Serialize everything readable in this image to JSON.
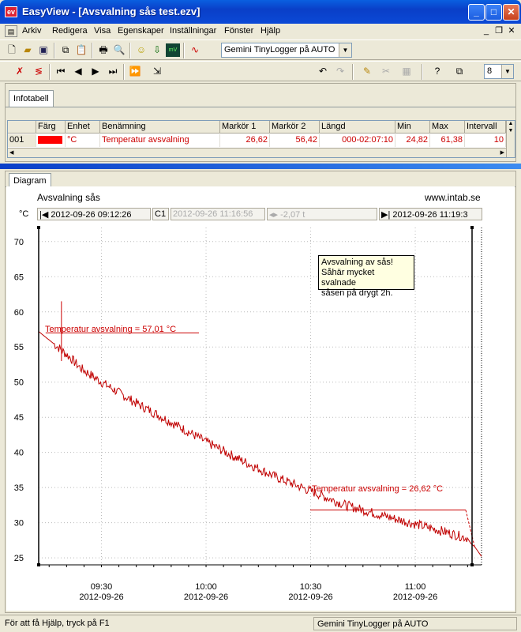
{
  "window": {
    "title": "EasyView - [Avsvalning sås test.ezv]",
    "icon": "ev"
  },
  "menu": [
    "Arkiv",
    "Redigera",
    "Visa",
    "Egenskaper",
    "Inställningar",
    "Fönster",
    "Hjälp"
  ],
  "toolbar": {
    "device": "Gemini TinyLogger på AUTO",
    "zoom": "8"
  },
  "info_tab": "Infotabell",
  "table": {
    "headers": [
      "Färg",
      "Enhet",
      "Benämning",
      "Markör 1",
      "Markör 2",
      "Längd",
      "Min",
      "Max",
      "Intervall"
    ],
    "rows": [
      {
        "num": "001",
        "color": "#ff0000",
        "unit": "°C",
        "name": "Temperatur avsvalning",
        "m1": "26,62",
        "m2": "56,42",
        "length": "000-02:07:10",
        "min": "24,82",
        "max": "61,38",
        "interval": "10"
      }
    ]
  },
  "diagram_tab": "Diagram",
  "diagram": {
    "subtitle": "Avsvalning sås",
    "site": "www.intab.se",
    "unit": "°C",
    "start": "2012-09-26 09:12:26",
    "c1_label": "C1",
    "c1_time": "2012-09-26 11:16:56",
    "delta": "-2,07 t",
    "end": "2012-09-26 11:19:3",
    "note": [
      "Avsvalning av sås!",
      "Såhär mycket svalnade",
      "såsen på drygt 2h."
    ],
    "marker1_label": "Temperatur avsvalning = 57,01 °C",
    "marker2_label": "Temperatur avsvalning = 26,62 °C"
  },
  "chart_data": {
    "type": "line",
    "ylim": [
      24,
      72
    ],
    "yticks": [
      25,
      30,
      35,
      40,
      45,
      50,
      55,
      60,
      65,
      70
    ],
    "xticks": [
      {
        "t": "09:30",
        "d": "2012-09-26"
      },
      {
        "t": "10:00",
        "d": "2012-09-26"
      },
      {
        "t": "10:30",
        "d": "2012-09-26"
      },
      {
        "t": "11:00",
        "d": "2012-09-26"
      }
    ],
    "xlim_min": [
      552,
      679
    ],
    "series": [
      {
        "name": "Temperatur avsvalning",
        "color": "#c00000",
        "x_min": [
          552,
          555,
          558,
          561,
          564,
          570,
          580,
          590,
          600,
          610,
          620,
          630,
          640,
          650,
          660,
          670,
          675,
          676,
          677,
          679
        ],
        "y": [
          57.2,
          56.0,
          54.8,
          53.5,
          52.0,
          50.0,
          47.0,
          44.3,
          41.5,
          38.9,
          36.5,
          34.5,
          32.5,
          31.1,
          29.8,
          28.5,
          27.8,
          27.0,
          26.6,
          25.2
        ]
      }
    ],
    "markers": [
      {
        "x_min": 554,
        "value": 57.01
      },
      {
        "x_min": 677,
        "value": 26.62
      }
    ]
  },
  "status": {
    "help": "För att få Hjälp, tryck på F1",
    "device": "Gemini TinyLogger på AUTO"
  }
}
